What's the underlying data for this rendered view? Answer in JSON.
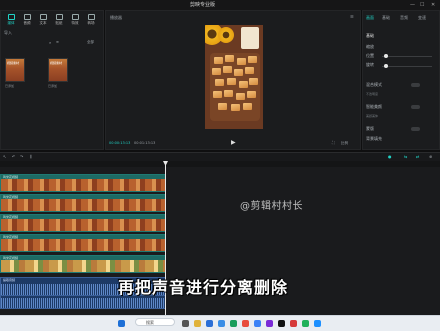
{
  "window": {
    "title": "剪映专业版"
  },
  "media_panel": {
    "tabs": [
      "媒体",
      "音频",
      "文本",
      "贴纸",
      "特效",
      "转场",
      "滤镜"
    ],
    "import_label": "导入",
    "search_placeholder": "搜索",
    "filter_label": "全部",
    "thumb1_caption": "视频素材",
    "thumb2_caption": "视频素材",
    "thumb1_label": "已添加",
    "thumb2_label": "已添加"
  },
  "player": {
    "title": "播放器",
    "timecode": "00:00:13:13",
    "duration": "00:01:13:13",
    "ratio_label": "比例"
  },
  "inspector": {
    "tabs": [
      "画面",
      "基础",
      "音频",
      "变速"
    ],
    "section": "基础",
    "rows": [
      "缩放",
      "位置",
      "旋转",
      "混合模式",
      "不透明度",
      "智能美颜",
      "美颜美体",
      "蒙版",
      "背景填充"
    ]
  },
  "timeline": {
    "tracks": [
      "鸡米花视频",
      "鸡米花视频",
      "鸡米花视频",
      "鸡米花视频",
      "鸡米花视频",
      "鸡米花视频"
    ],
    "audio_label": "提取音频"
  },
  "overlay": {
    "watermark": "@剪辑村村长",
    "subtitle": "再把声音进行分离删除"
  },
  "taskbar": {
    "search": "搜索"
  },
  "colors": {
    "accent": "#21d3c6",
    "track": "#1d6a64",
    "audio": "#1d3a66"
  }
}
